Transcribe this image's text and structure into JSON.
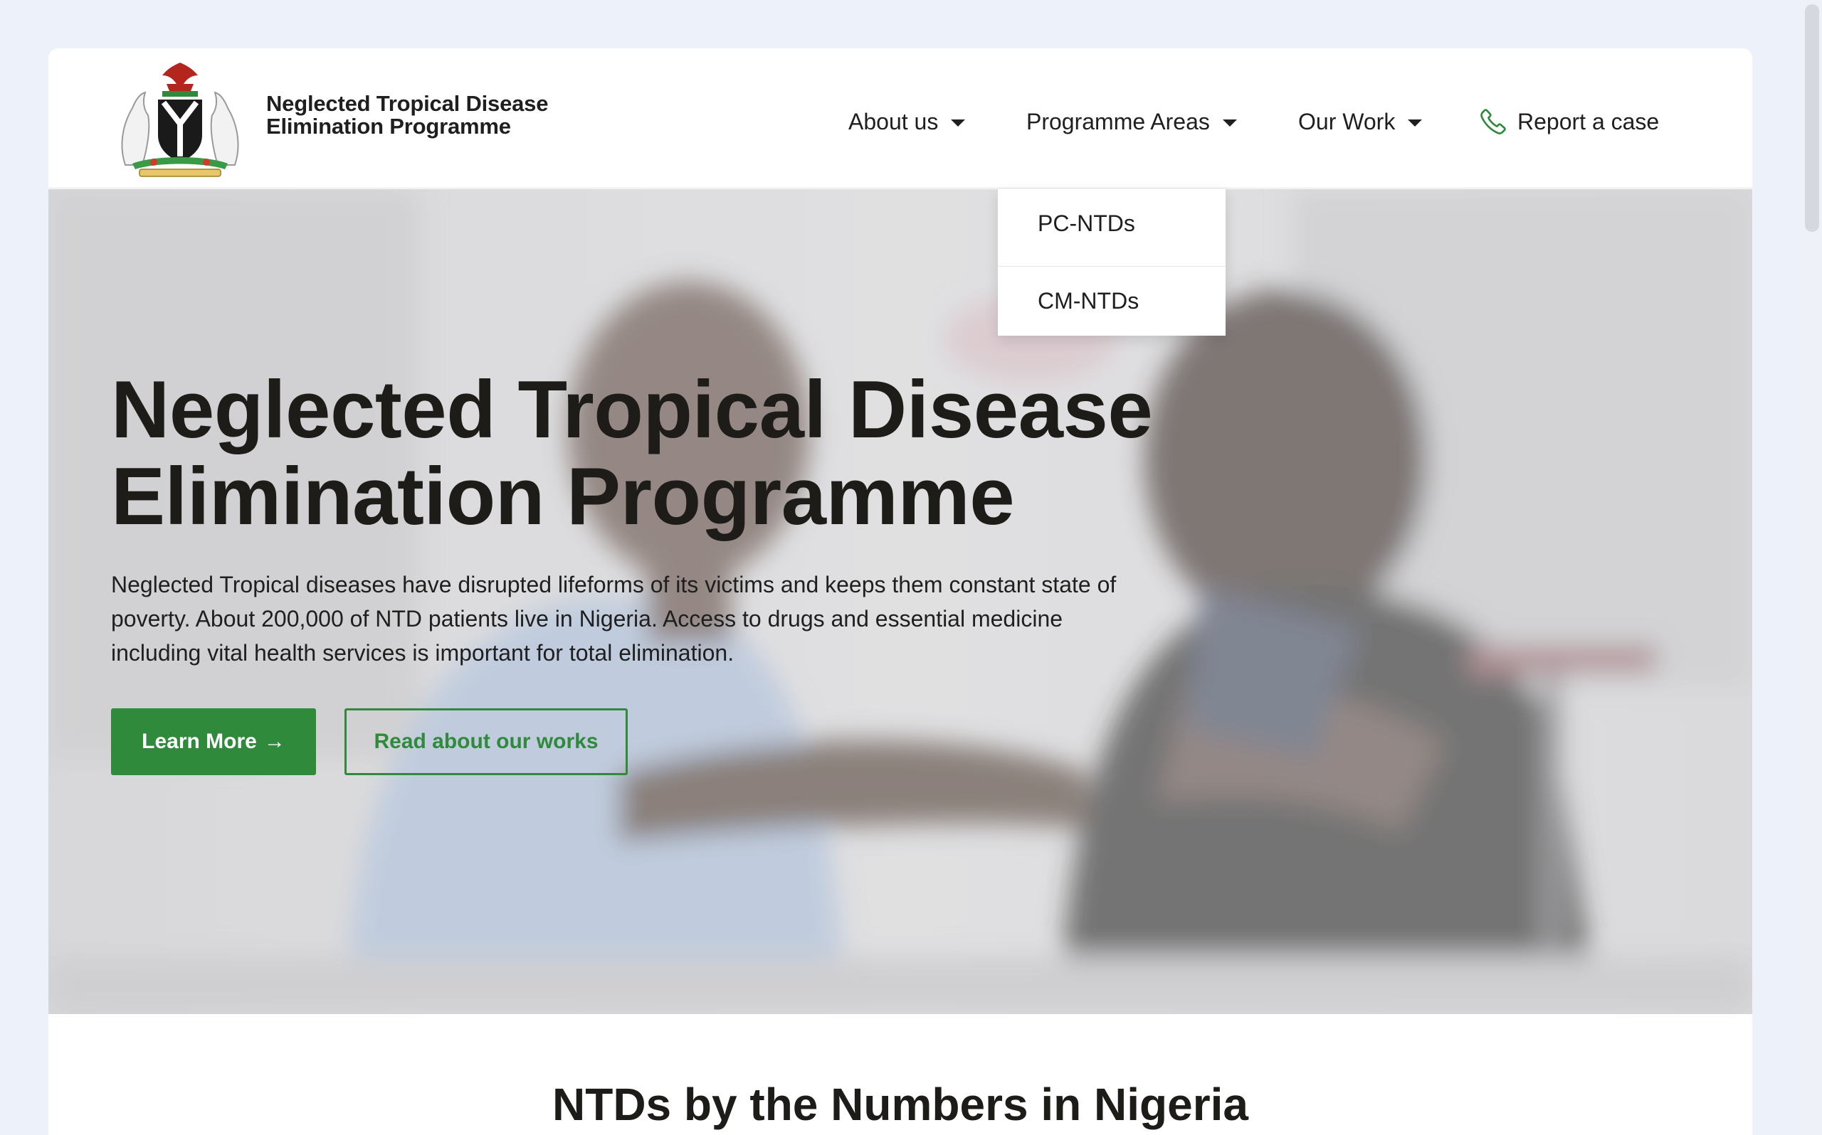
{
  "brand": {
    "line1": "Neglected Tropical Disease",
    "line2": "Elimination Programme",
    "logo_icon": "nigeria-coat-of-arms"
  },
  "nav": {
    "about": "About us",
    "programme_areas": "Programme Areas",
    "our_work": "Our Work",
    "report": "Report a case"
  },
  "dropdown": {
    "items": [
      "PC-NTDs",
      "CM-NTDs"
    ]
  },
  "hero": {
    "title_line1": "Neglected Tropical Disease",
    "title_line2": "Elimination Programme",
    "description": "Neglected Tropical diseases have disrupted lifeforms of its victims and keeps them constant state of poverty. About 200,000 of NTD patients live in Nigeria. Access to drugs and essential medicine including vital health services is important for total elimination.",
    "primary_button": "Learn More",
    "primary_arrow": "→",
    "secondary_button": "Read about our works"
  },
  "section": {
    "title": "NTDs by the Numbers in Nigeria"
  },
  "colors": {
    "accent": "#2f8a3c",
    "page_bg": "#edf1f9",
    "text": "#1f1f1f"
  }
}
